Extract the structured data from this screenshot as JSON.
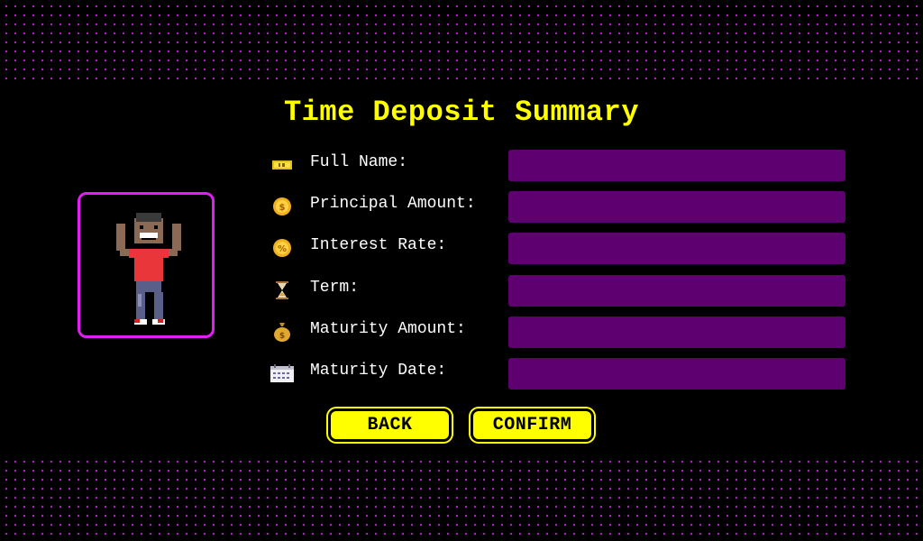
{
  "page": {
    "title": "Time Deposit Summary"
  },
  "avatar": {
    "icon": "pixel-person-cheering"
  },
  "fields": [
    {
      "icon": "ticket-icon",
      "label": "Full Name:",
      "value": ""
    },
    {
      "icon": "coin-icon",
      "label": "Principal Amount:",
      "value": ""
    },
    {
      "icon": "coin-percent-icon",
      "label": "Interest Rate:",
      "value": ""
    },
    {
      "icon": "hourglass-icon",
      "label": "Term:",
      "value": ""
    },
    {
      "icon": "money-bag-icon",
      "label": "Maturity Amount:",
      "value": ""
    },
    {
      "icon": "calendar-icon",
      "label": "Maturity Date:",
      "value": ""
    }
  ],
  "buttons": {
    "back_label": "BACK",
    "confirm_label": "CONFIRM"
  },
  "colors": {
    "background": "#000000",
    "accent_yellow": "#ffff00",
    "accent_magenta": "#e020f0",
    "field_purple": "#5f0070"
  }
}
